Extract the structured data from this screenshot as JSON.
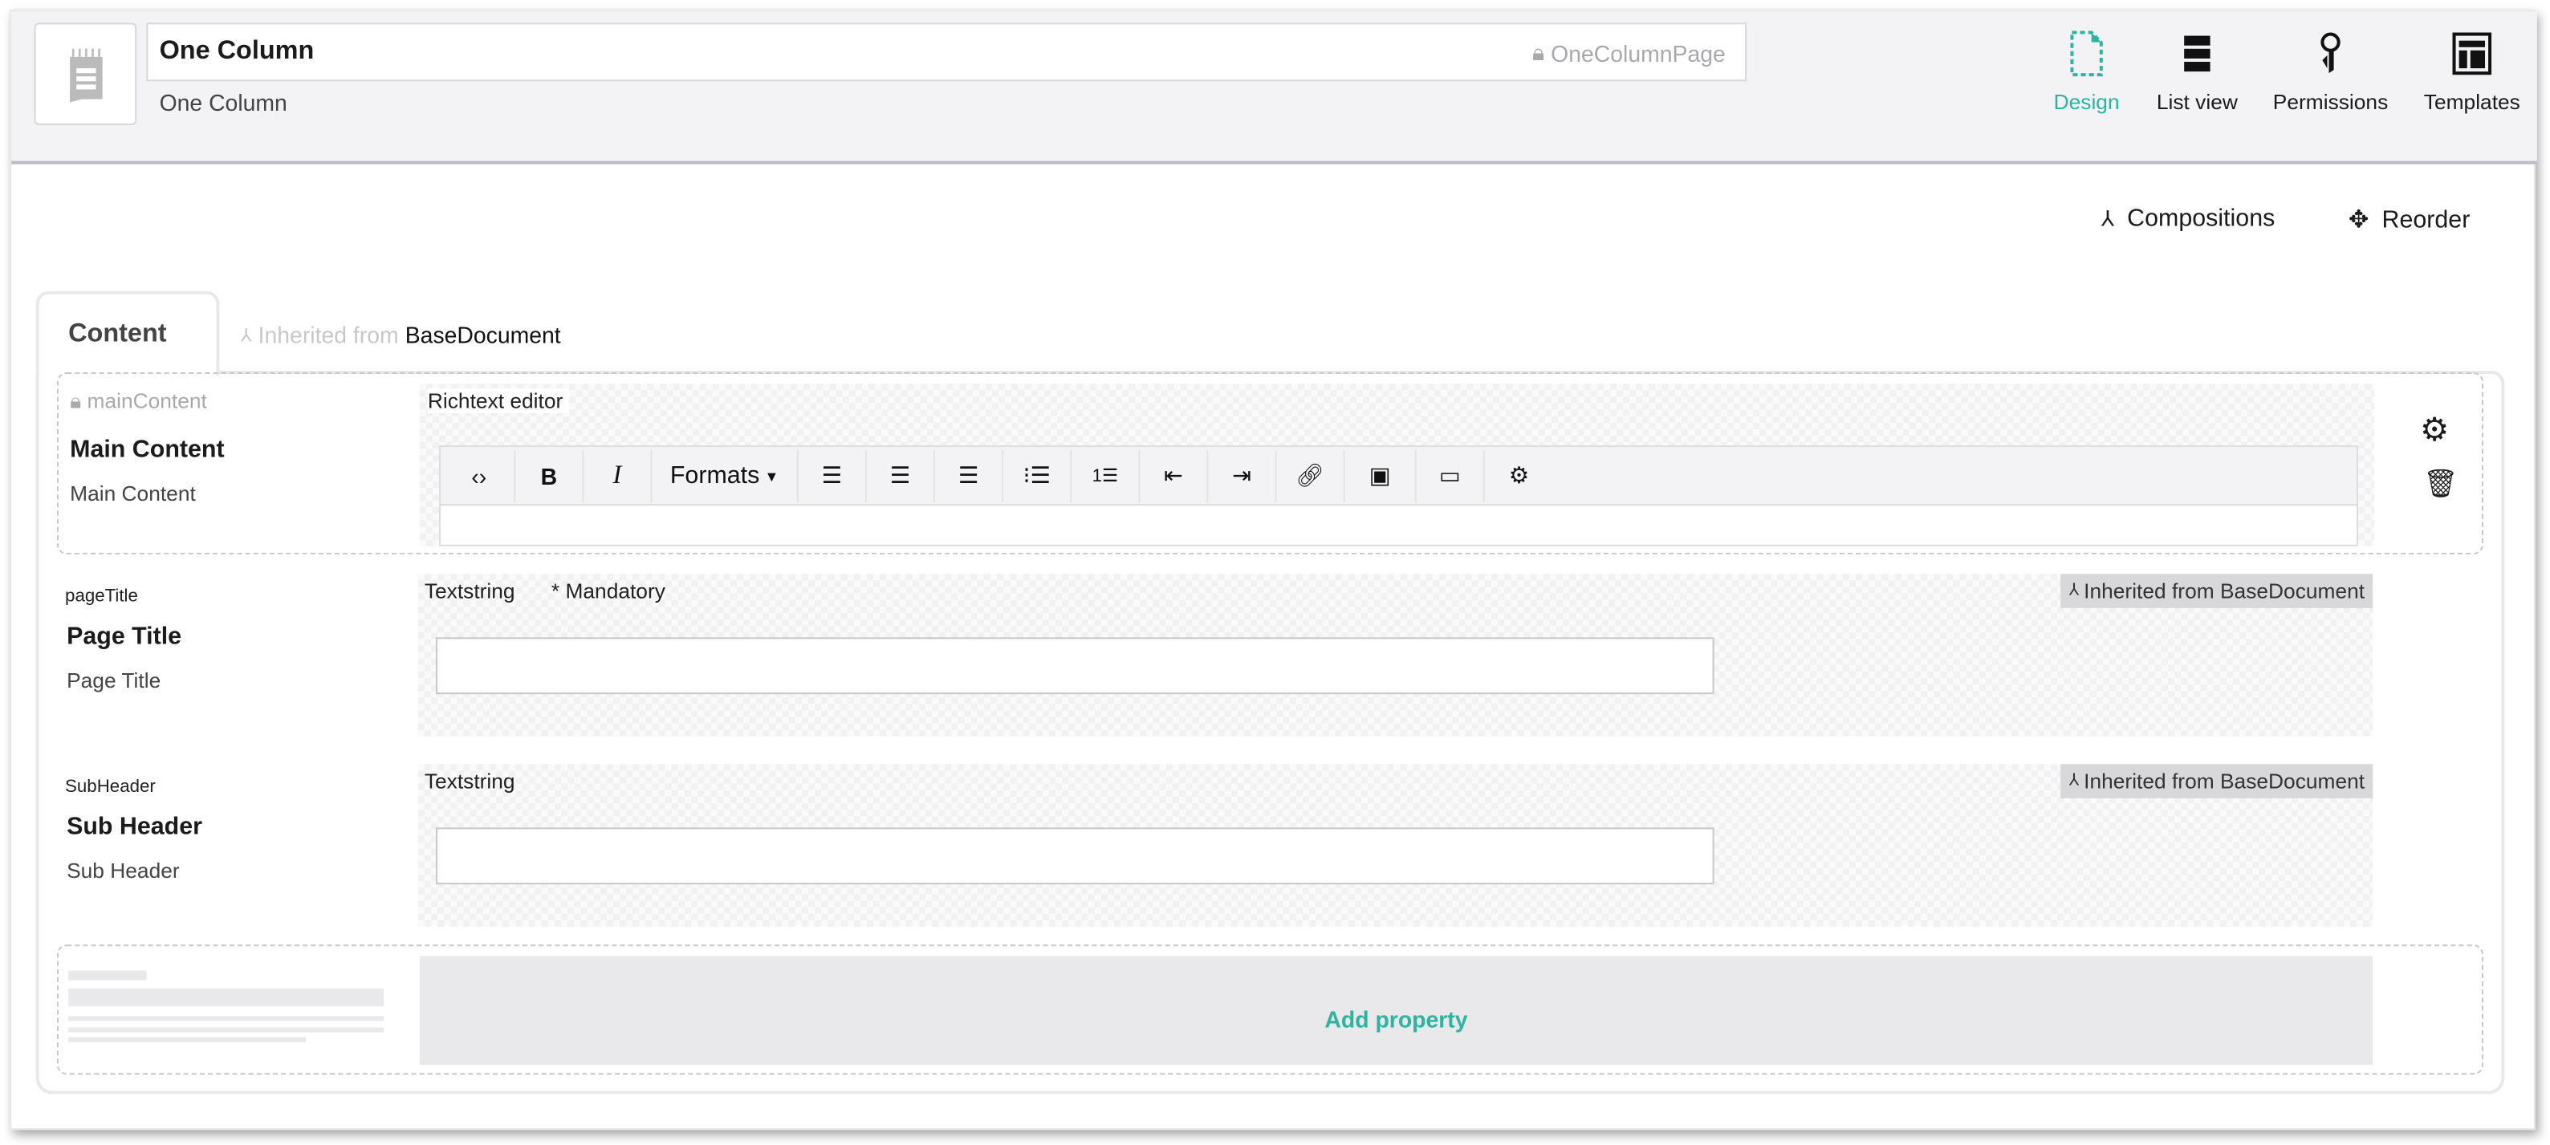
{
  "header": {
    "name": "One Column",
    "alias": "OneColumnPage",
    "description": "One Column",
    "doc_icon": "document-list-icon"
  },
  "nav": [
    {
      "label": "Design",
      "icon": "design-icon",
      "active": true
    },
    {
      "label": "List view",
      "icon": "list-view-icon"
    },
    {
      "label": "Permissions",
      "icon": "keys-icon"
    },
    {
      "label": "Templates",
      "icon": "templates-icon"
    }
  ],
  "actions": {
    "compositions": "Compositions",
    "reorder": "Reorder"
  },
  "tab": {
    "label": "Content",
    "inherited_prefix": "Inherited from",
    "inherited_from": "BaseDocument"
  },
  "properties": [
    {
      "alias": "mainContent",
      "name": "Main Content",
      "description": "Main Content",
      "editor": "Richtext editor",
      "locked": true
    },
    {
      "alias": "pageTitle",
      "name": "Page Title",
      "description": "Page Title",
      "editor": "Textstring",
      "mandatory": "* Mandatory",
      "inherited": "Inherited from BaseDocument",
      "value": ""
    },
    {
      "alias": "SubHeader",
      "name": "Sub Header",
      "description": "Sub Header",
      "editor": "Textstring",
      "inherited": "Inherited from BaseDocument",
      "value": ""
    }
  ],
  "toolbar": {
    "formats": "Formats",
    "buttons": [
      "code",
      "bold",
      "italic",
      "formats",
      "align-left",
      "align-center",
      "align-right",
      "bullet-list",
      "numbered-list",
      "outdent",
      "indent",
      "link",
      "image",
      "embed",
      "macro"
    ]
  },
  "add_property": "Add property",
  "colors": {
    "accent": "#2bb5a0",
    "header_bg": "#f3f3f5",
    "badge_bg": "#d8d7d9"
  }
}
